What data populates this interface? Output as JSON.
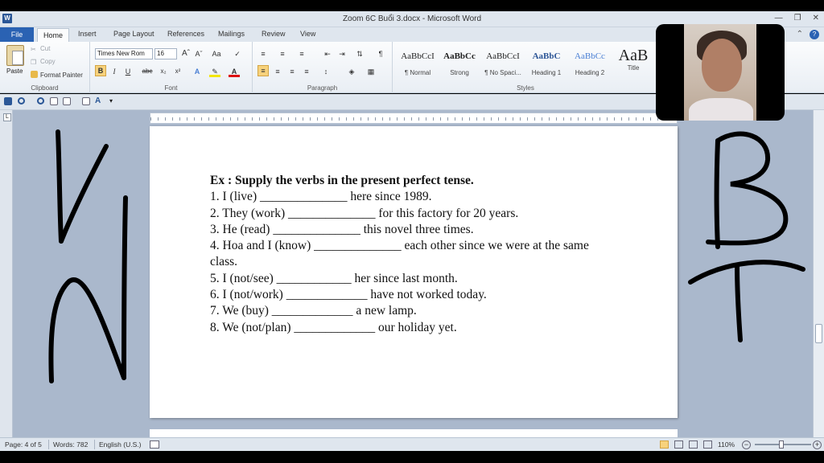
{
  "window": {
    "title": "Zoom 6C Buổi 3.docx - Microsoft Word",
    "app_icon": "W"
  },
  "tabs": {
    "file": "File",
    "items": [
      "Home",
      "Insert",
      "Page Layout",
      "References",
      "Mailings",
      "Review",
      "View"
    ],
    "active": "Home"
  },
  "ribbon": {
    "clipboard": {
      "label": "Clipboard",
      "paste": "Paste",
      "cut": "Cut",
      "copy": "Copy",
      "format_painter": "Format Painter"
    },
    "font": {
      "label": "Font",
      "face": "Times New Rom",
      "size": "16"
    },
    "paragraph": {
      "label": "Paragraph"
    },
    "styles": {
      "label": "Styles",
      "items": [
        {
          "sample": "AaBbCcI",
          "name": "¶ Normal"
        },
        {
          "sample": "AaBbCc",
          "name": "Strong"
        },
        {
          "sample": "AaBbCcI",
          "name": "¶ No Spaci..."
        },
        {
          "sample": "AaBbC",
          "name": "Heading 1"
        },
        {
          "sample": "AaBbCc",
          "name": "Heading 2"
        },
        {
          "sample": "AaB",
          "name": "Title"
        }
      ]
    }
  },
  "document": {
    "heading": "Ex : Supply the verbs in the present perfect tense.",
    "lines": [
      "1. I (live) ______________ here since 1989.",
      "2. They (work) ______________ for this factory for 20 years.",
      "3. He (read) ______________ this novel three times.",
      "4. Hoa and I (know) ______________ each other since we were at the same",
      "class.",
      "5. I (not/see) ____________ her since last month.",
      "6. I (not/work) _____________ have not worked today.",
      "7. We (buy) _____________ a new lamp.",
      "8. We (not/plan) _____________ our holiday yet."
    ]
  },
  "status": {
    "page": "Page: 4 of 5",
    "words": "Words: 782",
    "language": "English (U.S.)",
    "zoom": "110%"
  },
  "colors": {
    "file_tab": "#2a62b3",
    "ink": "#000000",
    "workspace": "#aab8cc"
  }
}
